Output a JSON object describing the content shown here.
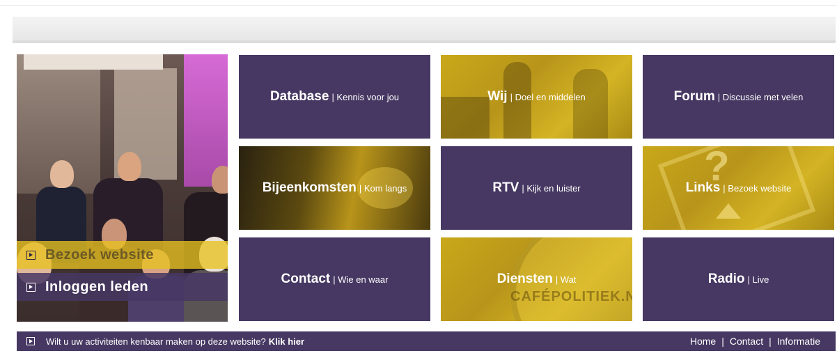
{
  "photo_panel": {
    "visit_label": "Bezoek website",
    "login_label": "Inloggen leden"
  },
  "tiles": [
    {
      "title": "Database",
      "subtitle": "| Kennis voor jou"
    },
    {
      "title": "Wij",
      "subtitle": "| Doel en middelen"
    },
    {
      "title": "Forum",
      "subtitle": "| Discussie met velen"
    },
    {
      "title": "Bijeenkomsten",
      "subtitle": "| Kom langs"
    },
    {
      "title": "RTV",
      "subtitle": "| Kijk en luister"
    },
    {
      "title": "Links",
      "subtitle": "| Bezoek website"
    },
    {
      "title": "Contact",
      "subtitle": "| Wie en waar"
    },
    {
      "title": "Diensten",
      "subtitle": "| Wat"
    },
    {
      "title": "Radio",
      "subtitle": "| Live"
    }
  ],
  "cafe_logo_text": "CAFÉPOLITIEK.NL",
  "footer": {
    "message": "Wilt u uw activiteiten kenbaar maken op deze website?",
    "cta": "Klik hier",
    "links": [
      "Home",
      "Contact",
      "Informatie"
    ],
    "separator": "|"
  },
  "colors": {
    "purple": "#463862",
    "gold": "#c9a81a"
  }
}
